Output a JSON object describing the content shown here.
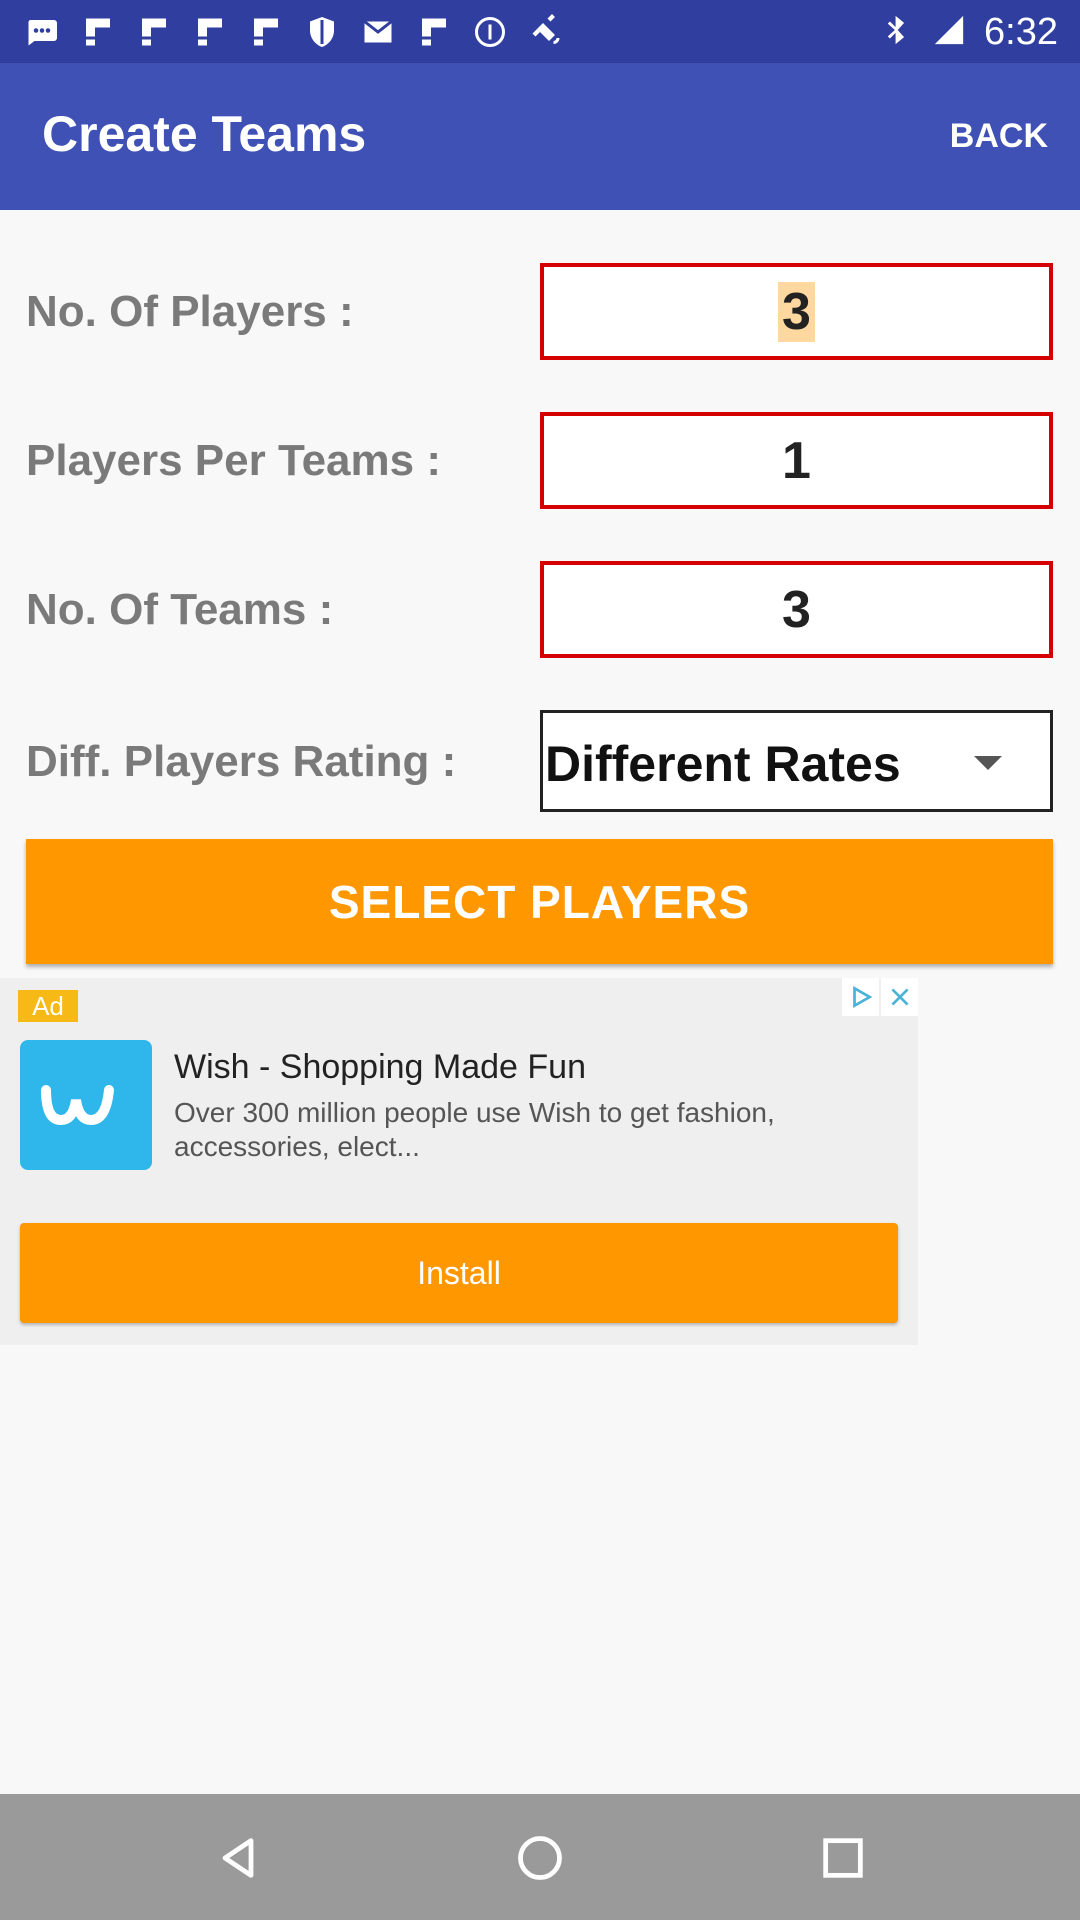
{
  "status_bar": {
    "time": "6:32",
    "icons": [
      "messages-icon",
      "flipboard-icon",
      "flipboard-icon",
      "flipboard-icon",
      "flipboard-icon",
      "shield-icon",
      "mail-icon",
      "flipboard-icon",
      "info-icon",
      "satellite-icon",
      "bluetooth-icon",
      "signal-icon"
    ]
  },
  "app_bar": {
    "title": "Create Teams",
    "back_label": "BACK"
  },
  "form": {
    "players_label": "No. Of Players :",
    "players_value": "3",
    "per_team_label": "Players Per Teams :",
    "per_team_value": "1",
    "teams_label": "No. Of Teams :",
    "teams_value": "3",
    "rating_label": "Diff. Players Rating :",
    "rating_value": "Different Rates",
    "select_button": "SELECT PLAYERS"
  },
  "ad": {
    "badge": "Ad",
    "title": "Wish - Shopping Made Fun",
    "description": "Over 300 million people use Wish to get fashion, accessories, elect...",
    "install_label": "Install",
    "logo_color": "#2fb7ec"
  },
  "colors": {
    "primary": "#3f51b5",
    "primary_dark": "#303f9f",
    "accent": "#ff9800",
    "field_border": "#d50000"
  }
}
